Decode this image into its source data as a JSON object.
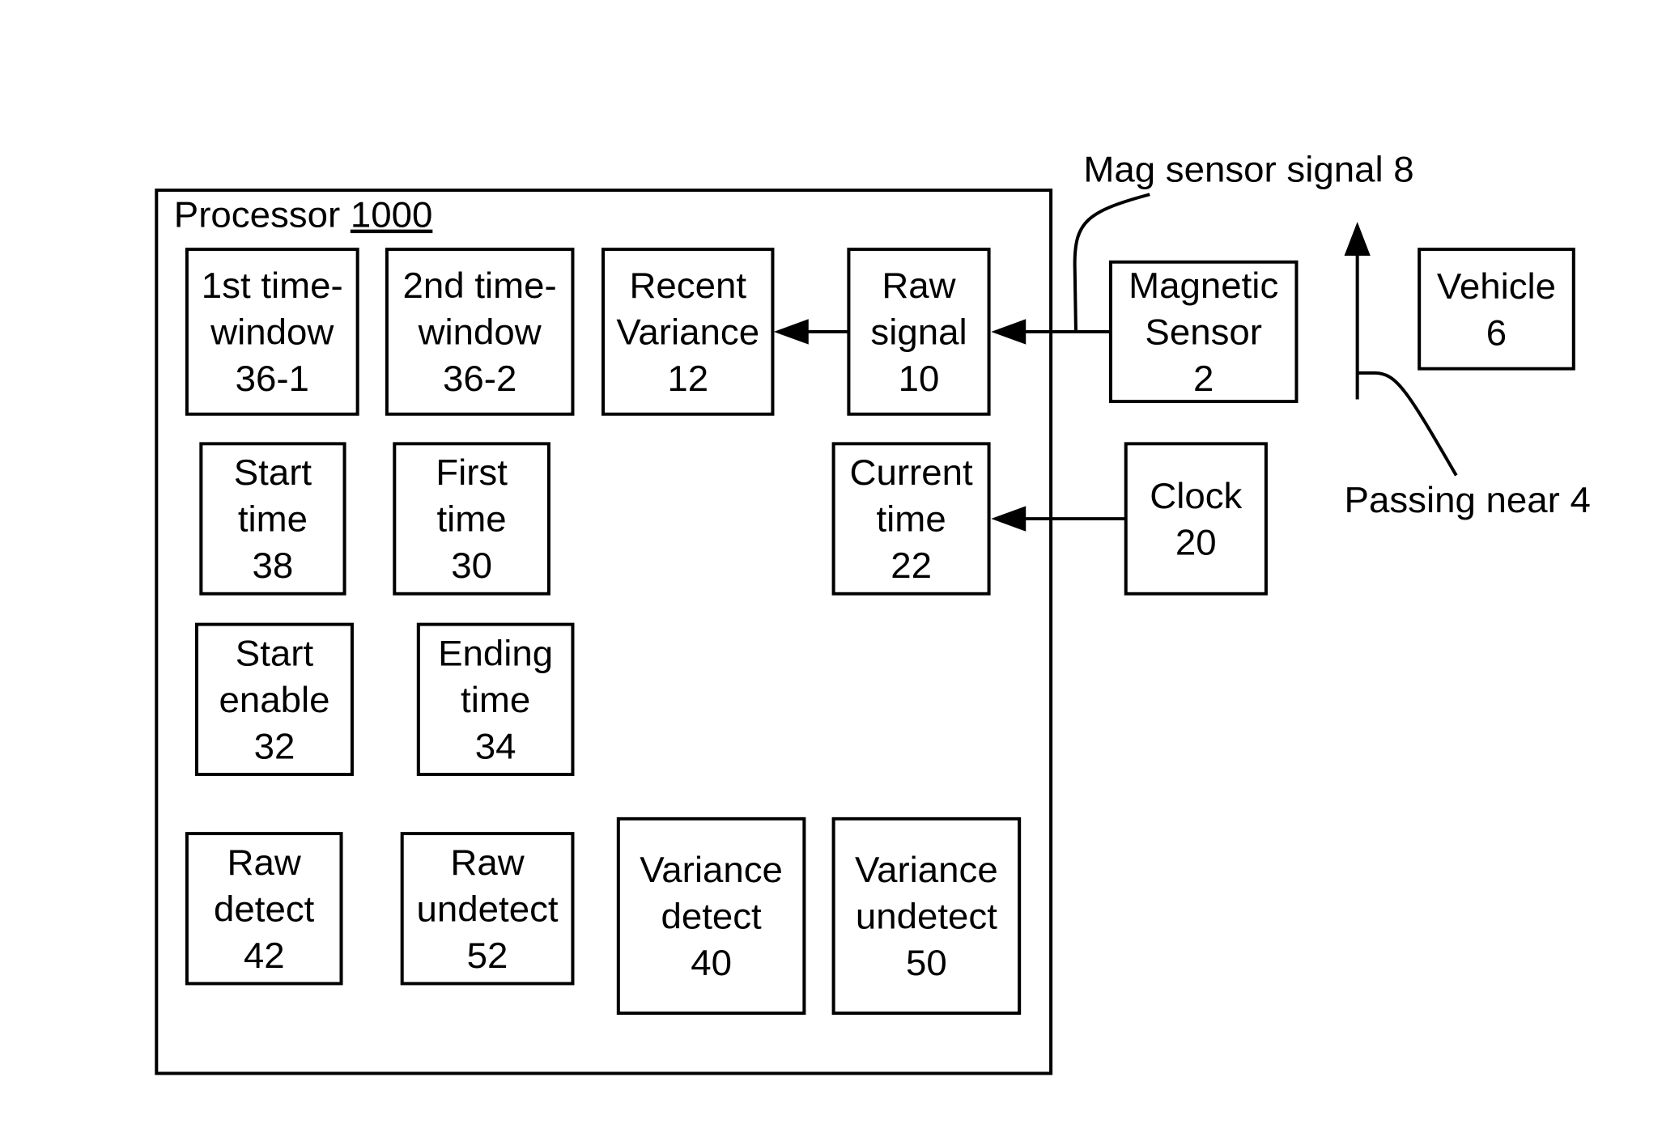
{
  "processor": {
    "label": "Processor",
    "number": "1000"
  },
  "blocks": [
    {
      "id": "first-time-window",
      "lines": [
        "1st time-",
        "window",
        "36-1"
      ]
    },
    {
      "id": "second-time-window",
      "lines": [
        "2nd time-",
        "window",
        "36-2"
      ]
    },
    {
      "id": "recent-variance",
      "lines": [
        "Recent",
        "Variance",
        "12"
      ]
    },
    {
      "id": "raw-signal",
      "lines": [
        "Raw",
        "signal",
        "10"
      ]
    },
    {
      "id": "start-time",
      "lines": [
        "Start",
        "time",
        "38"
      ]
    },
    {
      "id": "first-time",
      "lines": [
        "First",
        "time",
        "30"
      ]
    },
    {
      "id": "current-time",
      "lines": [
        "Current",
        "time",
        "22"
      ]
    },
    {
      "id": "start-enable",
      "lines": [
        "Start",
        "enable",
        "32"
      ]
    },
    {
      "id": "ending-time",
      "lines": [
        "Ending",
        "time",
        "34"
      ]
    },
    {
      "id": "raw-detect",
      "lines": [
        "Raw",
        "detect",
        "42"
      ]
    },
    {
      "id": "raw-undetect",
      "lines": [
        "Raw",
        "undetect",
        "52"
      ]
    },
    {
      "id": "variance-detect",
      "lines": [
        "Variance",
        "detect",
        "40"
      ]
    },
    {
      "id": "variance-undetect",
      "lines": [
        "Variance",
        "undetect",
        "50"
      ]
    },
    {
      "id": "magnetic-sensor",
      "lines": [
        "Magnetic",
        "Sensor",
        "2"
      ]
    },
    {
      "id": "clock",
      "lines": [
        "Clock",
        "20"
      ]
    },
    {
      "id": "vehicle",
      "lines": [
        "Vehicle",
        "6"
      ]
    }
  ],
  "annotations": {
    "mag_sensor_signal": "Mag sensor signal 8",
    "passing_near": "Passing near 4"
  }
}
